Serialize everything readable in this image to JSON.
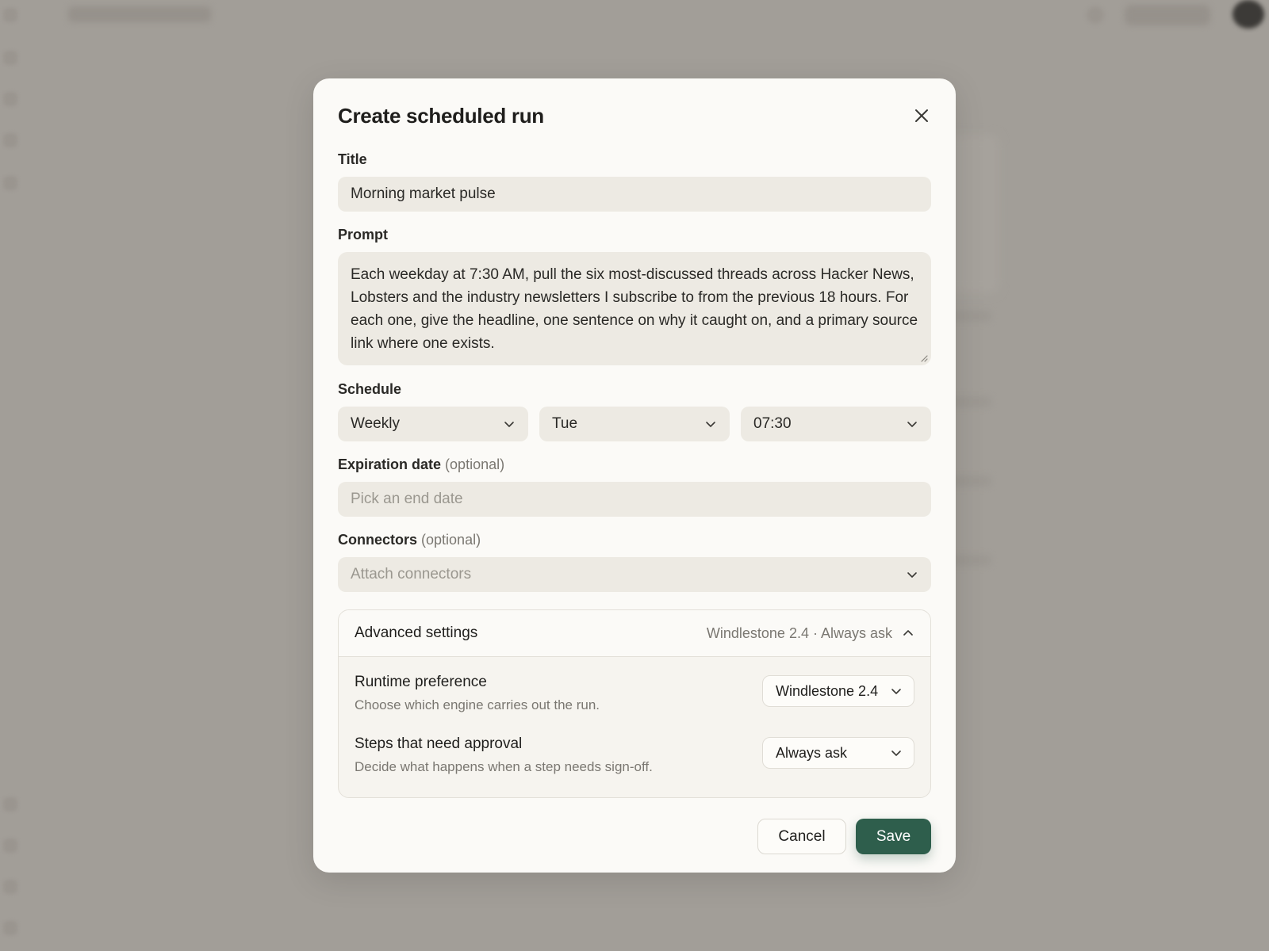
{
  "modal": {
    "title": "Create scheduled run"
  },
  "form": {
    "title": {
      "label": "Title",
      "value": "Morning market pulse"
    },
    "prompt": {
      "label": "Prompt",
      "value": "Each weekday at 7:30 AM, pull the six most-discussed threads across Hacker News, Lobsters and the industry newsletters I subscribe to from the previous 18 hours. For each one, give the headline, one sentence on why it caught on, and a primary source link where one exists."
    },
    "schedule": {
      "label": "Schedule",
      "frequency": "Weekly",
      "day": "Tue",
      "time": "07:30"
    },
    "expiration": {
      "label": "Expiration date",
      "optional": "(optional)",
      "placeholder": "Pick an end date"
    },
    "connectors": {
      "label": "Connectors",
      "optional": "(optional)",
      "placeholder": "Attach connectors"
    }
  },
  "advanced": {
    "title": "Advanced settings",
    "summary": "Windlestone 2.4 · Always ask",
    "runtime": {
      "title": "Runtime preference",
      "description": "Choose which engine carries out the run.",
      "value": "Windlestone 2.4"
    },
    "approval": {
      "title": "Steps that need approval",
      "description": "Decide what happens when a step needs sign-off.",
      "value": "Always ask"
    }
  },
  "actions": {
    "cancel": "Cancel",
    "save": "Save"
  },
  "colors": {
    "primary": "#2e5e4c",
    "field_bg": "#edeae3",
    "modal_bg": "#fbfaf7",
    "overlay": "#a19d97"
  }
}
